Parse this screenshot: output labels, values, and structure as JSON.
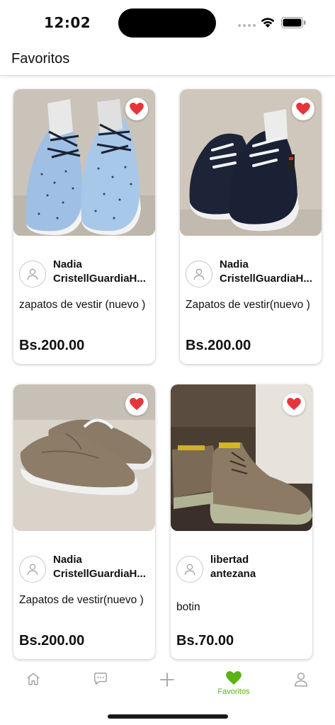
{
  "status_bar": {
    "time": "12:02"
  },
  "header": {
    "title": "Favoritos"
  },
  "products": [
    {
      "seller_line1": "Nadia",
      "seller_line2": "CristellGuardiaH...",
      "description": "zapatos de vestir (nuevo )",
      "price": "Bs.200.00",
      "favorited": true,
      "image": "light-blue-dotted-sneakers"
    },
    {
      "seller_line1": "Nadia",
      "seller_line2": "CristellGuardiaH...",
      "description": "Zapatos de vestir(nuevo )",
      "price": "Bs.200.00",
      "favorited": true,
      "image": "navy-slip-on-sneakers"
    },
    {
      "seller_line1": "Nadia",
      "seller_line2": "CristellGuardiaH...",
      "description": "Zapatos de vestir(nuevo )",
      "price": "Bs.200.00",
      "favorited": true,
      "image": "brown-boat-shoes"
    },
    {
      "seller_line1": "libertad",
      "seller_line2": "antezana",
      "description": "botin",
      "price": "Bs.70.00",
      "favorited": true,
      "image": "brown-work-boots"
    }
  ],
  "bottom_nav": {
    "items": [
      {
        "icon": "home-icon"
      },
      {
        "icon": "chat-icon"
      },
      {
        "icon": "plus-icon"
      },
      {
        "icon": "heart-icon",
        "label": "Favoritos",
        "active": true
      },
      {
        "icon": "user-icon"
      }
    ]
  },
  "colors": {
    "accent_green": "#5bb318",
    "heart_red": "#e5353b"
  }
}
